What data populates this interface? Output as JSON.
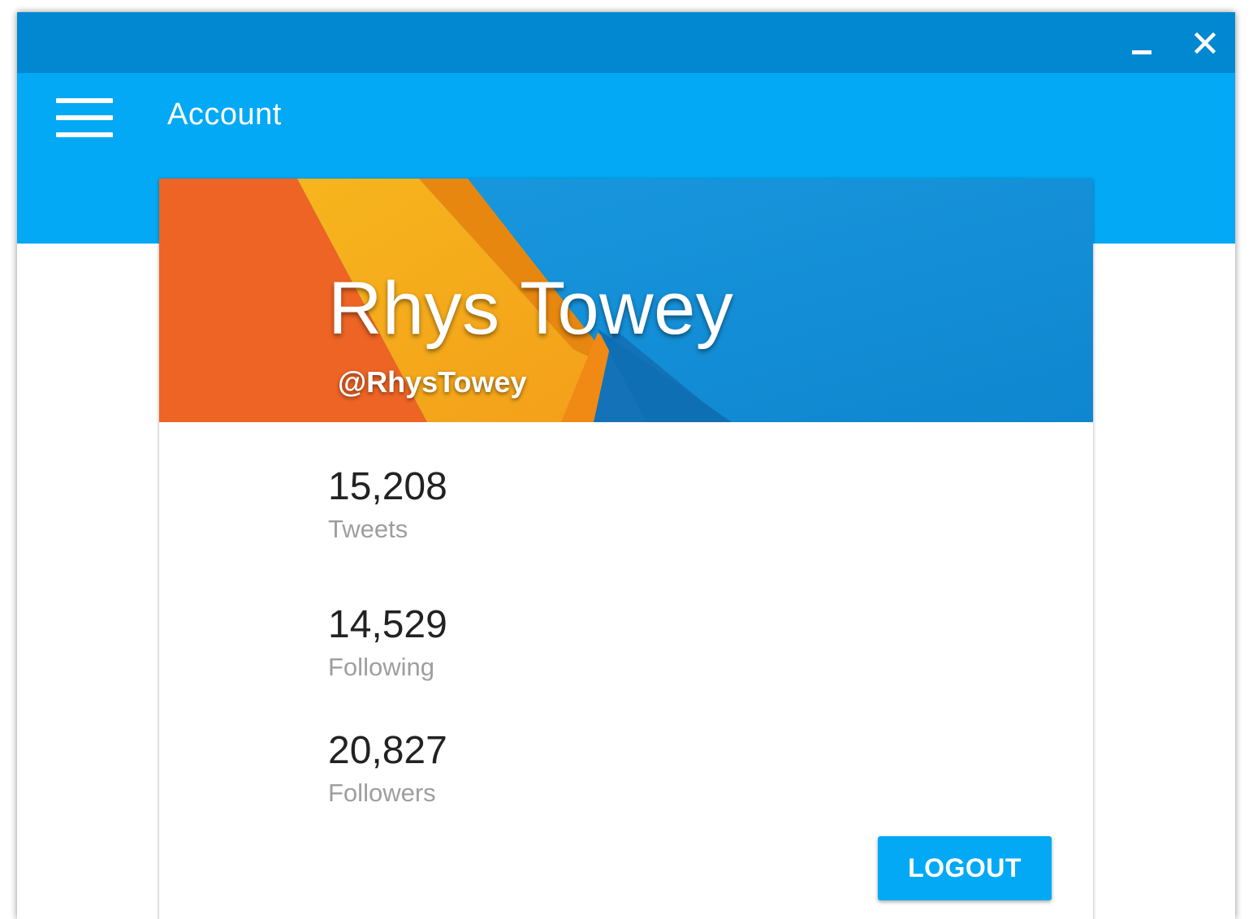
{
  "window": {
    "minimize_icon": "minimize-icon",
    "close_icon": "close-icon",
    "titlebar_color": "#0288d1"
  },
  "appbar": {
    "menu_icon": "hamburger-menu-icon",
    "title": "Account",
    "color": "#03a9f4"
  },
  "profile": {
    "name": "Rhys Towey",
    "handle": "@RhysTowey"
  },
  "stats": [
    {
      "value": "15,208",
      "label": "Tweets"
    },
    {
      "value": "14,529",
      "label": "Following"
    },
    {
      "value": "20,827",
      "label": "Followers"
    }
  ],
  "actions": {
    "logout_label": "LOGOUT",
    "accent": "#03a9f4"
  }
}
